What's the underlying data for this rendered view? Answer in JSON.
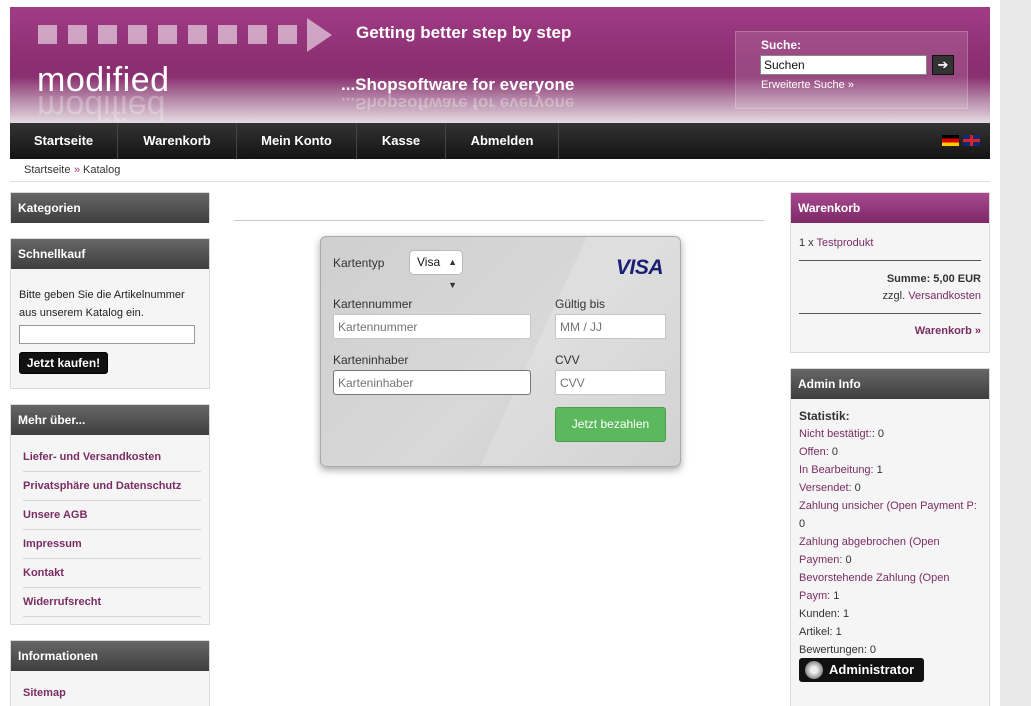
{
  "header": {
    "logo": "modified",
    "slogan_top": "Getting better step by step",
    "slogan_bottom": "...Shopsoftware for everyone",
    "search": {
      "label": "Suche:",
      "value": "Suchen",
      "button": "➔",
      "advanced": "Erweiterte Suche »"
    }
  },
  "nav": {
    "items": [
      "Startseite",
      "Warenkorb",
      "Mein Konto",
      "Kasse",
      "Abmelden"
    ]
  },
  "breadcrumb": {
    "home": "Startseite",
    "separator": "»",
    "current": "Katalog"
  },
  "left": {
    "categories_title": "Kategorien",
    "quickbuy": {
      "title": "Schnellkauf",
      "text1": "Bitte geben Sie die Artikelnummer",
      "text2": "aus unserem Katalog ein.",
      "button": "Jetzt kaufen!"
    },
    "more": {
      "title": "Mehr über...",
      "links": [
        "Liefer- und Versandkosten",
        "Privatsphäre und Datenschutz",
        "Unsere AGB",
        "Impressum",
        "Kontakt",
        "Widerrufsrecht"
      ]
    },
    "info": {
      "title": "Informationen",
      "links": [
        "Sitemap"
      ]
    }
  },
  "card": {
    "type_label": "Kartentyp",
    "type_value": "Visa",
    "brand": "VISA",
    "number_label": "Kartennummer",
    "number_placeholder": "Kartennummer",
    "expiry_label": "Gültig bis",
    "expiry_placeholder": "MM / JJ",
    "holder_label": "Karteninhaber",
    "holder_placeholder": "Karteninhaber",
    "cvv_label": "CVV",
    "cvv_placeholder": "CVV",
    "pay_button": "Jetzt bezahlen"
  },
  "cart": {
    "title": "Warenkorb",
    "qty_prefix": "1 x ",
    "product": "Testprodukt",
    "sum": "Summe: 5,00 EUR",
    "shipping_prefix": "zzgl. ",
    "shipping_link": "Versandkosten",
    "link": "Warenkorb »"
  },
  "admin": {
    "title": "Admin Info",
    "stats_title": "Statistik:",
    "stats": [
      {
        "label": "Nicht bestätigt:",
        "value": ": 0",
        "link": true
      },
      {
        "label": "Offen:",
        "value": " 0",
        "link": true
      },
      {
        "label": "In Bearbeitung:",
        "value": " 1",
        "link": true
      },
      {
        "label": "Versendet:",
        "value": " 0",
        "link": true
      },
      {
        "label": "Zahlung unsicher (Open Payment P:",
        "value": "",
        "link": true
      },
      {
        "label": "0",
        "value": "",
        "link": false
      },
      {
        "label": "Zahlung abgebrochen (Open",
        "value": "",
        "link": true
      },
      {
        "label": "Paymen:",
        "value": " 0",
        "link": true
      },
      {
        "label": "Bevorstehende Zahlung (Open",
        "value": "",
        "link": true
      },
      {
        "label": "Paym:",
        "value": " 1",
        "link": true
      },
      {
        "label": "Kunden: 1",
        "value": "",
        "link": false
      },
      {
        "label": "Artikel: 1",
        "value": "",
        "link": false
      },
      {
        "label": "Bewertungen: 0",
        "value": "",
        "link": false
      }
    ],
    "button": "Administrator"
  },
  "colors": {
    "brand": "#8d2f72",
    "link": "#7a2d63",
    "pay": "#5cb85c"
  }
}
